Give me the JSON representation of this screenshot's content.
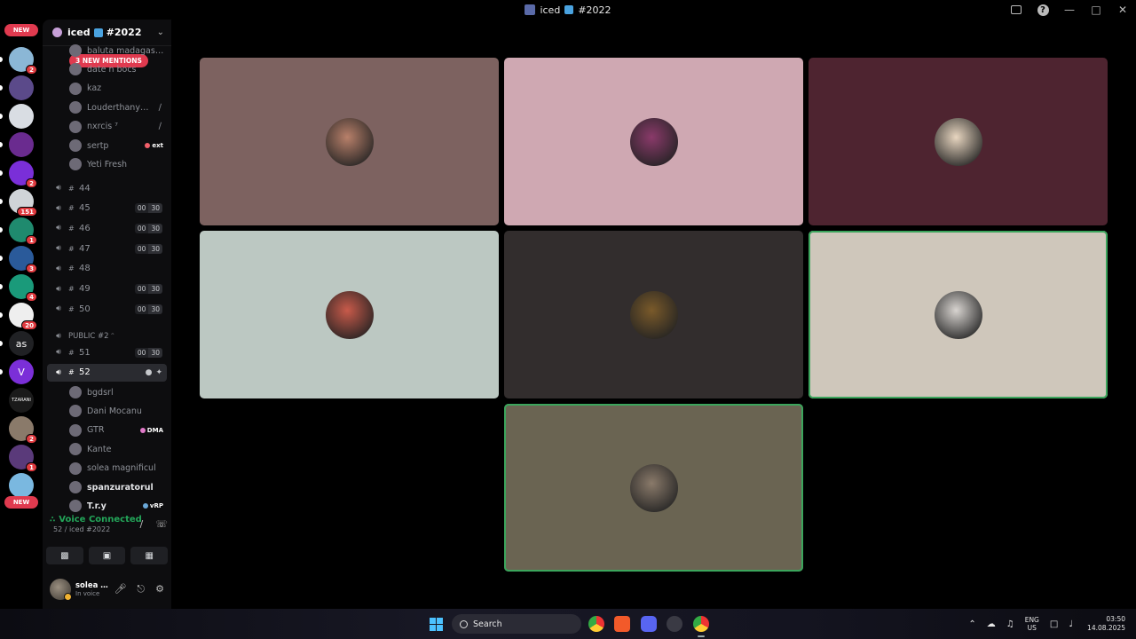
{
  "window": {
    "title": "iced",
    "title_suffix": "#2022"
  },
  "server_rail": {
    "new_top": "NEW",
    "new_bottom": "NEW",
    "servers": [
      {
        "badge": "2",
        "color": "#8bb7d6"
      },
      {
        "badge": "",
        "color": "#5b4a8a"
      },
      {
        "badge": "",
        "color": "#d9dde3"
      },
      {
        "badge": "",
        "color": "#6a2b8f"
      },
      {
        "badge": "2",
        "color": "#7a2fd8"
      },
      {
        "badge": "151",
        "color": "#d0d4d8"
      },
      {
        "badge": "1",
        "color": "#1f8a6e"
      },
      {
        "badge": "3",
        "color": "#2a5a9a"
      },
      {
        "badge": "4",
        "color": "#1a9a7a"
      },
      {
        "badge": "20",
        "color": "#eeeeee"
      },
      {
        "badge": "",
        "color": "#202124",
        "text": "as"
      },
      {
        "badge": "",
        "color": "#7b2fd8",
        "text": "V"
      },
      {
        "badge": "",
        "color": "#1a1a1a",
        "text": "TZARANI"
      },
      {
        "badge": "2",
        "color": "#8a7a6a"
      },
      {
        "badge": "1",
        "color": "#5a3a7a"
      },
      {
        "badge": "",
        "color": "#7ab8e0"
      }
    ]
  },
  "sidebar": {
    "guild_name": "iced",
    "guild_suffix": "#2022",
    "mentions_pill": "3 NEW MENTIONS",
    "top_users": [
      {
        "name": "baluta madagaskar",
        "tag": ""
      },
      {
        "name": "date n bocs",
        "tag": ""
      },
      {
        "name": "kaz",
        "tag": ""
      },
      {
        "name": "Louderthanyo...",
        "tag": "",
        "muted": true
      },
      {
        "name": "nxrcis ⁷",
        "tag": "",
        "muted": true
      },
      {
        "name": "sertp",
        "tag": "ext"
      },
      {
        "name": "Yeti Fresh",
        "tag": ""
      }
    ],
    "channels": [
      {
        "name": "44",
        "used": "",
        "limit": ""
      },
      {
        "name": "45",
        "used": "00",
        "limit": "30"
      },
      {
        "name": "46",
        "used": "00",
        "limit": "30"
      },
      {
        "name": "47",
        "used": "00",
        "limit": "30"
      },
      {
        "name": "48",
        "used": "",
        "limit": ""
      },
      {
        "name": "49",
        "used": "00",
        "limit": "30"
      },
      {
        "name": "50",
        "used": "00",
        "limit": "30"
      }
    ],
    "category": "PUBLIC #2 ᵔ",
    "channels_2": [
      {
        "name": "51",
        "used": "00",
        "limit": "30"
      },
      {
        "name": "52",
        "used": "",
        "limit": ""
      }
    ],
    "voice_users": [
      {
        "name": "bgdsrl",
        "tag": "",
        "bright": false
      },
      {
        "name": "Dani Mocanu",
        "tag": "",
        "bright": false
      },
      {
        "name": "GTR",
        "tag": "DMA",
        "bright": false
      },
      {
        "name": "Kante",
        "tag": "",
        "bright": false
      },
      {
        "name": "solea magnificul",
        "tag": "",
        "bright": false
      },
      {
        "name": "spanzuratorul",
        "tag": "",
        "bright": true
      },
      {
        "name": "T.r.y",
        "tag": "vRP",
        "bright": true
      }
    ]
  },
  "voice_panel": {
    "status": "Voice Connected",
    "channel_path": "52 / iced",
    "channel_suffix": "#2022"
  },
  "user_panel": {
    "name": "solea magnifi...",
    "status": "In voice"
  },
  "stage": {
    "tiles": [
      {
        "bg": "#7d6260",
        "avatar": "#b8806a",
        "speaking": false
      },
      {
        "bg": "#cfa8b2",
        "avatar": "#8a3a6a",
        "speaking": false
      },
      {
        "bg": "#4e2430",
        "avatar": "#e8d6c0",
        "speaking": false
      },
      {
        "bg": "#bcc8c2",
        "avatar": "#c85a4a",
        "speaking": false
      },
      {
        "bg": "#322d2d",
        "avatar": "#7a5a2a",
        "speaking": false
      },
      {
        "bg": "#cfc7bb",
        "avatar": "#d8d4d0",
        "speaking": true
      },
      {
        "bg": "#6a6452",
        "avatar": "#8a7a6a",
        "speaking": true
      }
    ]
  },
  "taskbar": {
    "search_label": "Search",
    "lang_line1": "ENG",
    "lang_line2": "US",
    "time": "03:50",
    "date": "14.08.2025"
  }
}
